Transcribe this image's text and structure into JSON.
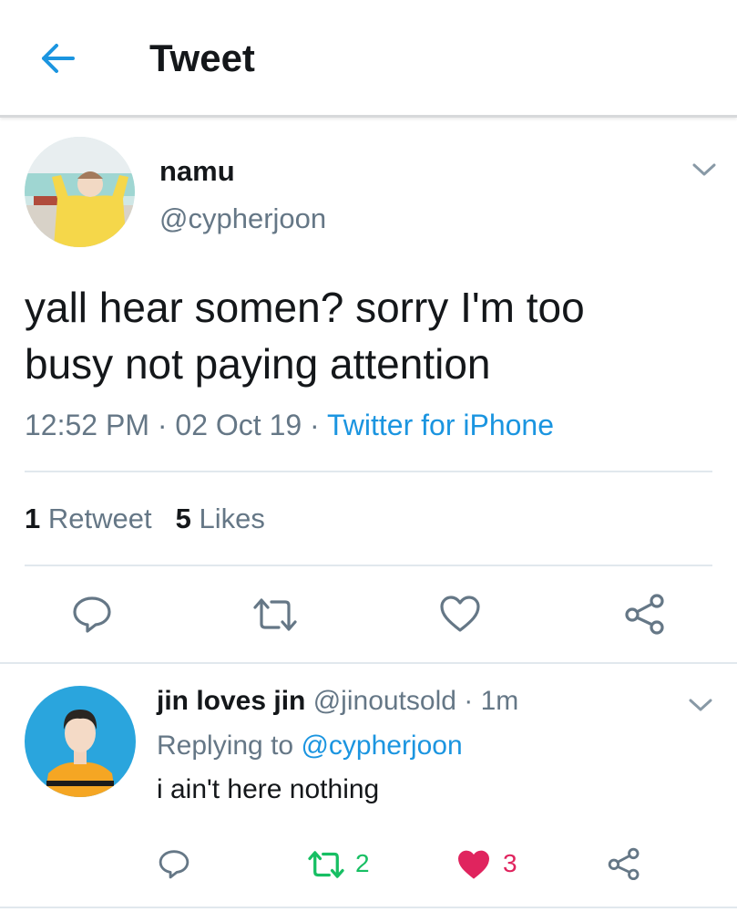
{
  "header": {
    "title": "Tweet",
    "back_icon": "back-arrow-icon"
  },
  "tweet": {
    "display_name": "namu",
    "handle": "@cypherjoon",
    "text_line1": "yall hear somen? sorry I'm too",
    "text_line2": "busy not paying attention",
    "time": "12:52 PM",
    "date": "02 Oct 19",
    "source": "Twitter for iPhone",
    "separator": " · ",
    "retweet_count": "1",
    "retweet_label": "Retweet",
    "like_count": "5",
    "like_label": "Likes",
    "actions": [
      "reply-icon",
      "retweet-icon",
      "like-icon",
      "share-icon"
    ]
  },
  "reply": {
    "display_name": "jin loves jin",
    "handle": "@jinoutsold",
    "time": "1m",
    "replying_to_label": "Replying to",
    "replying_to_handle": "@cypherjoon",
    "text": "i ain't here nothing",
    "retweet_count": "2",
    "like_count": "3"
  },
  "colors": {
    "accent": "#1b95e0",
    "retweet_active": "#17bf63",
    "like_active": "#e0245e",
    "secondary_text": "#657786",
    "icon_gray": "#657786"
  }
}
